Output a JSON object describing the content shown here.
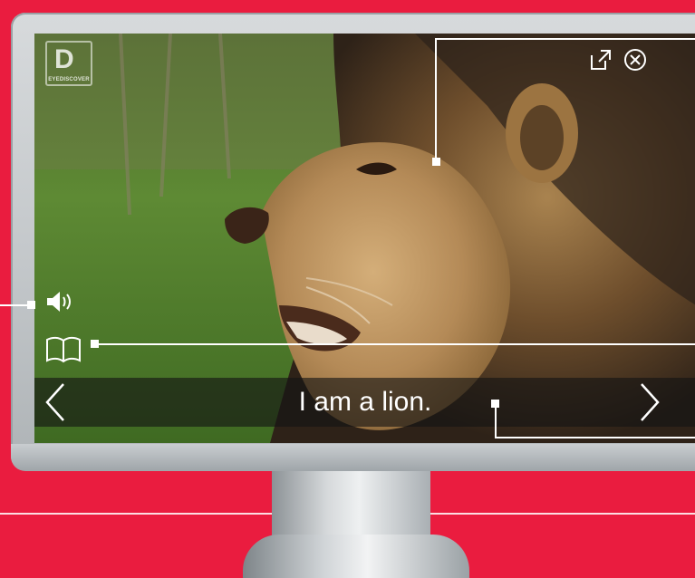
{
  "viewer": {
    "logo": {
      "mark": "D",
      "wordmark": "EYEDISCOVER"
    },
    "caption": "I am a lion.",
    "icons": {
      "external_link": "external-link-icon",
      "close": "close-circle-x-icon",
      "audio": "speaker-icon",
      "book": "open-book-icon",
      "prev": "chevron-left-icon",
      "next": "chevron-right-icon"
    }
  },
  "colors": {
    "background": "#ea1c3f",
    "caption_bar": "#141414",
    "text": "#ffffff"
  }
}
